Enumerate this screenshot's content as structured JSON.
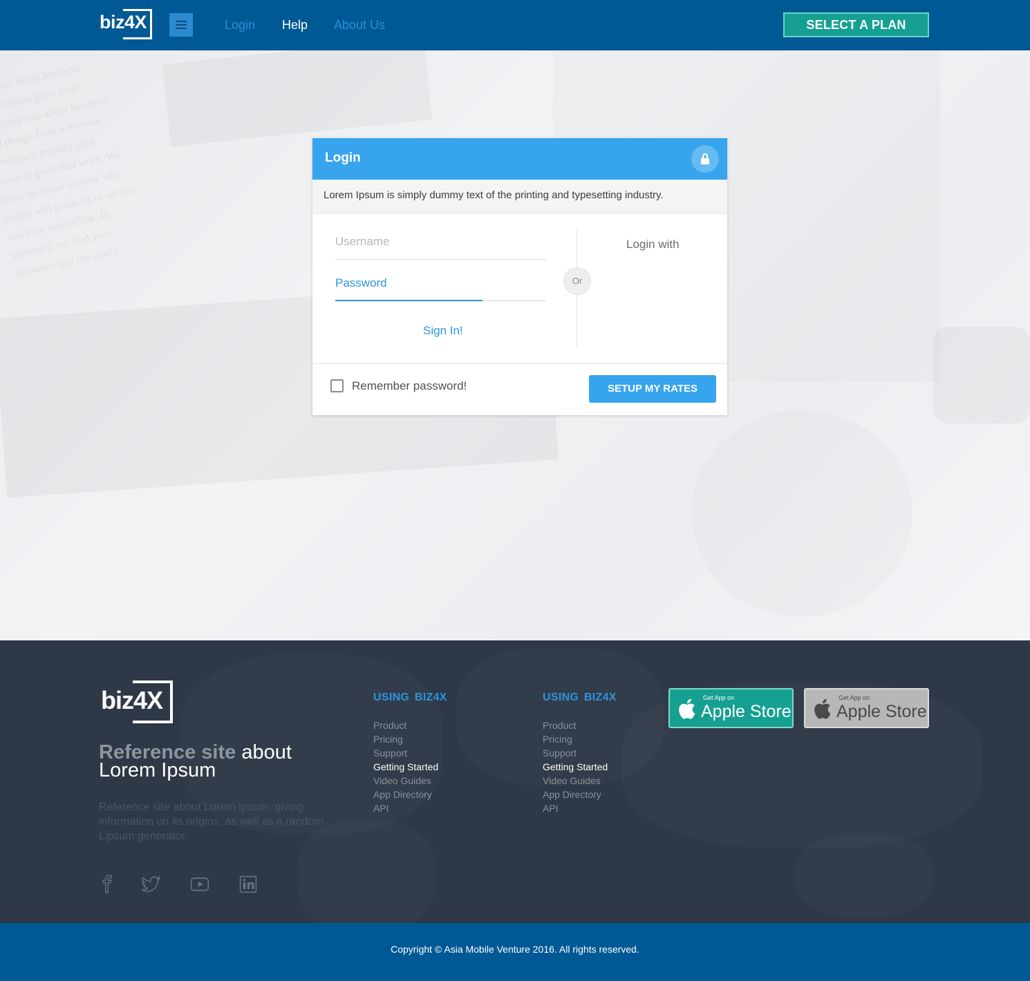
{
  "header": {
    "logo_text": "biz4X",
    "nav": {
      "login": "Login",
      "help": "Help",
      "about": "About Us"
    },
    "cta_label": "SELECT A PLAN",
    "colors": {
      "bar": "#005995",
      "cta": "#16a092",
      "link": "#2f8ed3"
    }
  },
  "login_card": {
    "title": "Login",
    "description": "Lorem Ipsum is simply dummy text of the printing and typesetting industry.",
    "username_placeholder": "Username",
    "password_label": "Password",
    "sign_in_label": "Sign In!",
    "divider_label": "Or",
    "login_with_label": "Login with",
    "remember_label": "Remember password!",
    "remember_checked": false,
    "setup_button_label": "SETUP MY RATES",
    "accent_color": "#37a4ee"
  },
  "hero_background_text": "business. We're business partnerships grow your company into about business and design from a revenue generation amplify your business goals that work. We focus on actual reasons why people will products or service and their and offline. In summary, we find your greatness and the world.",
  "footer": {
    "logo_text": "biz4X",
    "heading_dim": "Reference site",
    "heading_rest_1": "about",
    "heading_rest_2": "Lorem Ipsum",
    "paragraph": "Reference site about Lorem Ipsum, giving information on its origins, as well as a random Lipsum generator.",
    "social_icons": [
      "facebook-icon",
      "twitter-icon",
      "youtube-icon",
      "linkedin-icon"
    ],
    "columns": [
      {
        "title": "USING  BIZ4X",
        "items": [
          "Product",
          "Pricing",
          "Support",
          "Getting Started",
          "Video Guides",
          "App Directory",
          "API"
        ],
        "active_index": 3
      },
      {
        "title": "USING  BIZ4X",
        "items": [
          "Product",
          "Pricing",
          "Support",
          "Getting Started",
          "Video Guides",
          "App Directory",
          "API"
        ],
        "active_index": 3
      }
    ],
    "app_buttons": [
      {
        "small": "Get App on",
        "big": "Apple Store",
        "color": "#16a092"
      },
      {
        "small": "Get App on",
        "big": "Apple Store",
        "color": "#b7b7b7"
      }
    ],
    "copyright": "Copyright © Asia Mobile Venture 2016. All rights reserved."
  }
}
